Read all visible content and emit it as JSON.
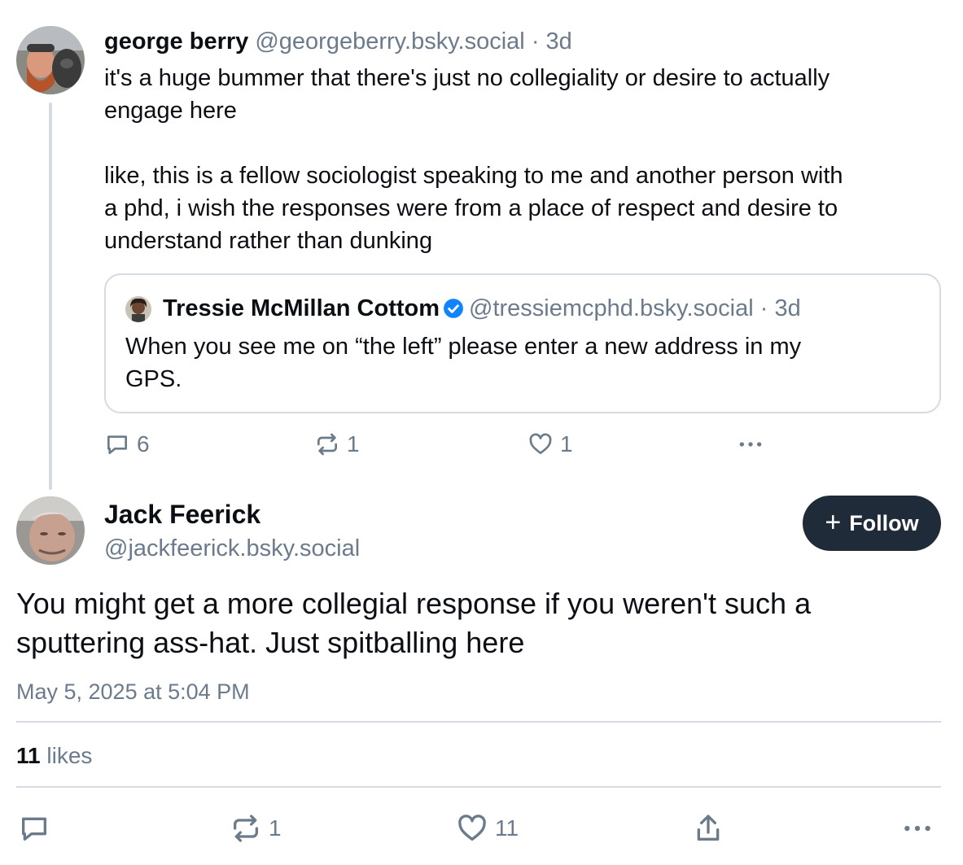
{
  "parent_post": {
    "author_name": "george berry",
    "author_handle": "@georgeberry.bsky.social",
    "separator": "·",
    "age": "3d",
    "body_paragraphs": [
      "it's a huge bummer that there's just no collegiality or desire to actually\nengage here",
      "like, this is a fellow sociologist speaking to me and another person with\na phd, i wish the responses were from a place of respect and desire to\nunderstand rather than dunking"
    ],
    "quote": {
      "author_name": "Tressie McMillan Cottom",
      "verified": true,
      "author_handle": "@tressiemcphd.bsky.social",
      "separator": "·",
      "age": "3d",
      "body": "When you see me on “the left” please enter a new address in my\nGPS."
    },
    "actions": {
      "reply_icon": "speech-bubble-icon",
      "reply_count": "6",
      "repost_icon": "repost-icon",
      "repost_count": "1",
      "like_icon": "heart-icon",
      "like_count": "1",
      "more_icon": "ellipsis-icon"
    }
  },
  "reply_post": {
    "author_name": "Jack Feerick",
    "author_handle": "@jackfeerick.bsky.social",
    "follow_button": {
      "icon": "plus-icon",
      "label": "Follow"
    },
    "body": "You might get a more collegial response if you weren't such a\nsputtering ass-hat. Just spitballing here",
    "timestamp": "May 5, 2025 at 5:04 PM",
    "likes_count": "11",
    "likes_label": "likes",
    "actions": {
      "reply_icon": "speech-bubble-icon",
      "repost_icon": "repost-icon",
      "repost_count": "1",
      "like_icon": "heart-icon",
      "like_count": "11",
      "share_icon": "share-icon",
      "more_icon": "ellipsis-icon"
    }
  },
  "colors": {
    "text": "#0b0f14",
    "muted": "#6b7b8c",
    "border": "#d4dbe2",
    "follow_bg": "#1f2b38",
    "verified": "#1083fe"
  }
}
